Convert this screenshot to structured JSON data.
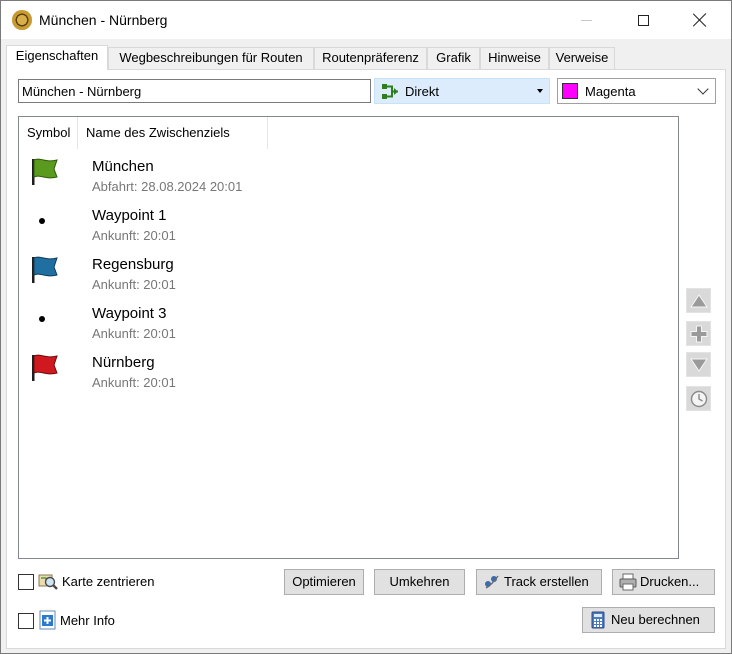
{
  "window": {
    "title": "München - Nürnberg",
    "icons": {
      "app": "gps-app-icon",
      "minimize": "minimize-icon",
      "maximize": "maximize-icon",
      "close": "close-icon"
    }
  },
  "tabs": [
    {
      "label": "Eigenschaften",
      "active": true
    },
    {
      "label": "Wegbeschreibungen für Routen",
      "active": false
    },
    {
      "label": "Routenpräferenz",
      "active": false
    },
    {
      "label": "Grafik",
      "active": false
    },
    {
      "label": "Hinweise",
      "active": false
    },
    {
      "label": "Verweise",
      "active": false
    }
  ],
  "route": {
    "name_value": "München - Nürnberg",
    "mode_label": "Direkt",
    "color_label": "Magenta",
    "color_hex": "#ff00ff"
  },
  "list": {
    "columns": [
      "Symbol",
      "Name des Zwischenziels"
    ],
    "rows": [
      {
        "icon": "green-flag-icon",
        "title": "München",
        "subtitle": "Abfahrt: 28.08.2024 20:01",
        "color": "#4f8f1f"
      },
      {
        "icon": "dot-icon",
        "title": "Waypoint 1",
        "subtitle": "Ankunft: 20:01",
        "color": "#000000"
      },
      {
        "icon": "blue-flag-icon",
        "title": "Regensburg",
        "subtitle": "Ankunft: 20:01",
        "color": "#1f6fa0"
      },
      {
        "icon": "dot-icon",
        "title": "Waypoint 3",
        "subtitle": "Ankunft: 20:01",
        "color": "#000000"
      },
      {
        "icon": "red-flag-icon",
        "title": "Nürnberg",
        "subtitle": "Ankunft: 20:01",
        "color": "#c0161d"
      }
    ]
  },
  "side_buttons": [
    "move-up-icon",
    "add-icon",
    "move-down-icon",
    "clock-icon"
  ],
  "bottom": {
    "center_map_label": "Karte zentrieren",
    "more_info_label": "Mehr Info",
    "optimize_label": "Optimieren",
    "reverse_label": "Umkehren",
    "create_track_label": "Track erstellen",
    "print_label": "Drucken...",
    "recalculate_label": "Neu berechnen"
  }
}
